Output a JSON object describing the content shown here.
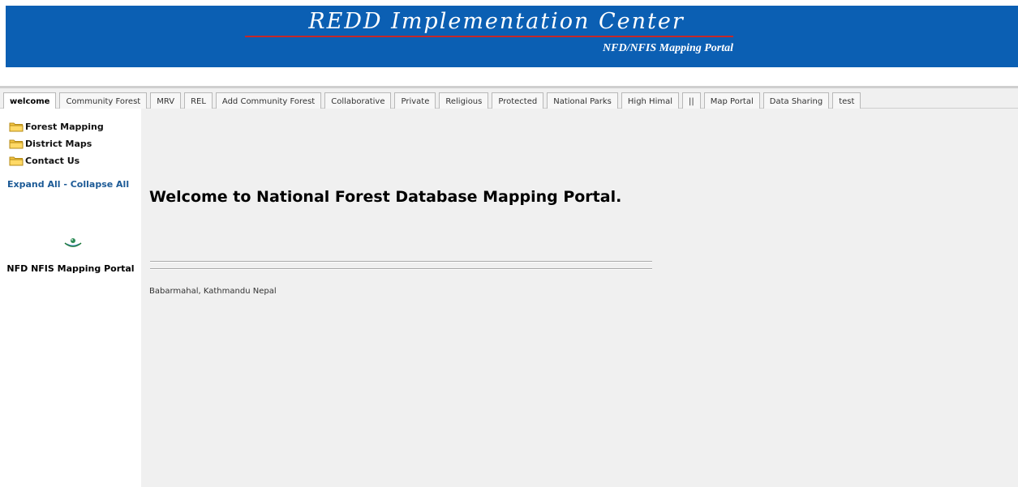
{
  "header": {
    "title": "REDD Implementation Center",
    "subtitle": "NFD/NFIS Mapping Portal",
    "background_color": "#0b5fb3",
    "underline_color": "#c62828"
  },
  "tabs": [
    {
      "label": "welcome",
      "active": true
    },
    {
      "label": "Community Forest",
      "active": false
    },
    {
      "label": "MRV",
      "active": false
    },
    {
      "label": "REL",
      "active": false
    },
    {
      "label": "Add Community Forest",
      "active": false
    },
    {
      "label": "Collaborative",
      "active": false
    },
    {
      "label": "Private",
      "active": false
    },
    {
      "label": "Religious",
      "active": false
    },
    {
      "label": "Protected",
      "active": false
    },
    {
      "label": "National Parks",
      "active": false
    },
    {
      "label": "High Himal",
      "active": false
    },
    {
      "label": "||",
      "active": false
    },
    {
      "label": "Map Portal",
      "active": false
    },
    {
      "label": "Data Sharing",
      "active": false
    },
    {
      "label": "test",
      "active": false
    }
  ],
  "sidebar": {
    "items": [
      {
        "label": "Forest Mapping",
        "icon": "folder-icon"
      },
      {
        "label": "District Maps",
        "icon": "folder-icon"
      },
      {
        "label": "Contact Us",
        "icon": "folder-icon"
      }
    ],
    "expand_label": "Expand All",
    "separator": " - ",
    "collapse_label": "Collapse All",
    "caption": "NFD NFIS Mapping Portal"
  },
  "main": {
    "heading": "Welcome to National Forest Database Mapping Portal.",
    "address": "Babarmahal, Kathmandu Nepal"
  }
}
